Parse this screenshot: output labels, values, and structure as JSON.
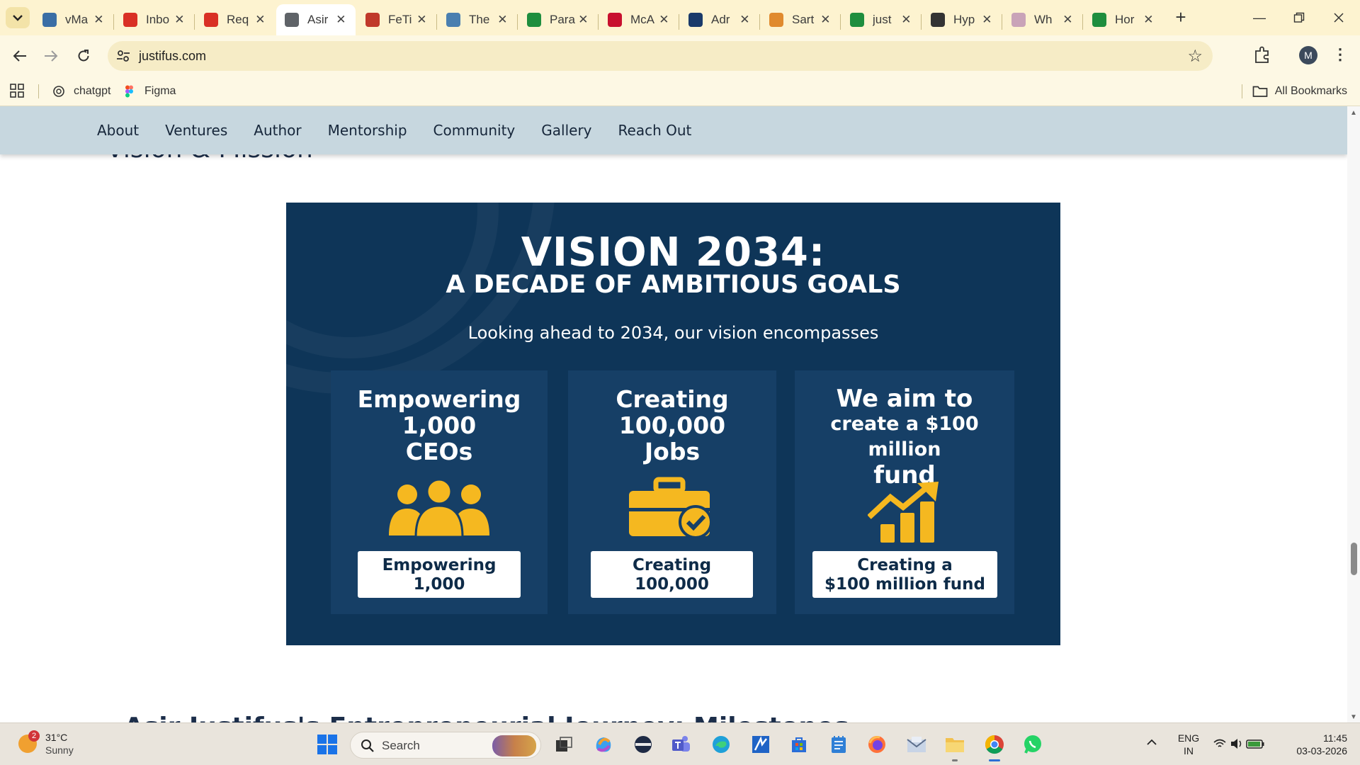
{
  "browser": {
    "tabs": [
      {
        "title": "vMa",
        "favicon": "vmail-icon",
        "color": "#3a6ea5"
      },
      {
        "title": "Inbo",
        "favicon": "gmail-icon",
        "color": "#d93025"
      },
      {
        "title": "Req",
        "favicon": "gmail-icon",
        "color": "#d93025"
      },
      {
        "title": "Asir",
        "favicon": "globe-icon",
        "color": "#5f6368",
        "active": true
      },
      {
        "title": "FeTi",
        "favicon": "fetch-icon",
        "color": "#c0392b"
      },
      {
        "title": "The",
        "favicon": "image-icon",
        "color": "#4a7fb0"
      },
      {
        "title": "Para",
        "favicon": "paradox-icon",
        "color": "#1e8e3e"
      },
      {
        "title": "McA",
        "favicon": "mcafee-icon",
        "color": "#c8102e"
      },
      {
        "title": "Adr",
        "favicon": "adr-icon",
        "color": "#1a3a6a"
      },
      {
        "title": "Sart",
        "favicon": "sarthi-icon",
        "color": "#e08a2e"
      },
      {
        "title": "just",
        "favicon": "sheets-icon",
        "color": "#1e8e3e"
      },
      {
        "title": "Hyp",
        "favicon": "openai-icon",
        "color": "#333333"
      },
      {
        "title": "Wh",
        "favicon": "circle-icon",
        "color": "#c9a3b8"
      },
      {
        "title": "Hor",
        "favicon": "sheets-icon",
        "color": "#1e8e3e"
      }
    ],
    "url": "justifus.com",
    "profile_initial": "M",
    "bookmarks": [
      {
        "label": "chatgpt",
        "icon": "openai-icon"
      },
      {
        "label": "Figma",
        "icon": "figma-icon"
      }
    ],
    "all_bookmarks_label": "All Bookmarks"
  },
  "site": {
    "nav": [
      "About",
      "Ventures",
      "Author",
      "Mentorship",
      "Community",
      "Gallery",
      "Reach Out"
    ],
    "section_heading": "Vision & Mission",
    "next_heading": "Asir Justifus's Entrepreneurial Journey: Milestones",
    "vision": {
      "title": "VISION 2034:",
      "subtitle": "A DECADE OF AMBITIOUS GOALS",
      "tagline": "Looking ahead to 2034, our vision encompasses",
      "cards": [
        {
          "head": [
            "Empowering",
            "1,000",
            "CEOs"
          ],
          "icon": "people-icon",
          "box": [
            "Empowering",
            "1,000"
          ]
        },
        {
          "head": [
            "Creating",
            "100,000",
            "Jobs"
          ],
          "icon": "briefcase-check-icon",
          "box": [
            "Creating",
            "100,000"
          ]
        },
        {
          "head": [
            "We aim to",
            "create a $100 million",
            "fund"
          ],
          "icon": "growth-chart-icon",
          "box": [
            "Creating a",
            "$100 million fund"
          ]
        }
      ],
      "accent_color": "#f5b820",
      "background_color": "#0e3558"
    }
  },
  "taskbar": {
    "weather_temp": "31°C",
    "weather_condition": "Sunny",
    "weather_badge": "2",
    "search_label": "Search",
    "lang_line1": "ENG",
    "lang_line2": "IN",
    "time": "11:45",
    "date": "03-03-2026"
  }
}
